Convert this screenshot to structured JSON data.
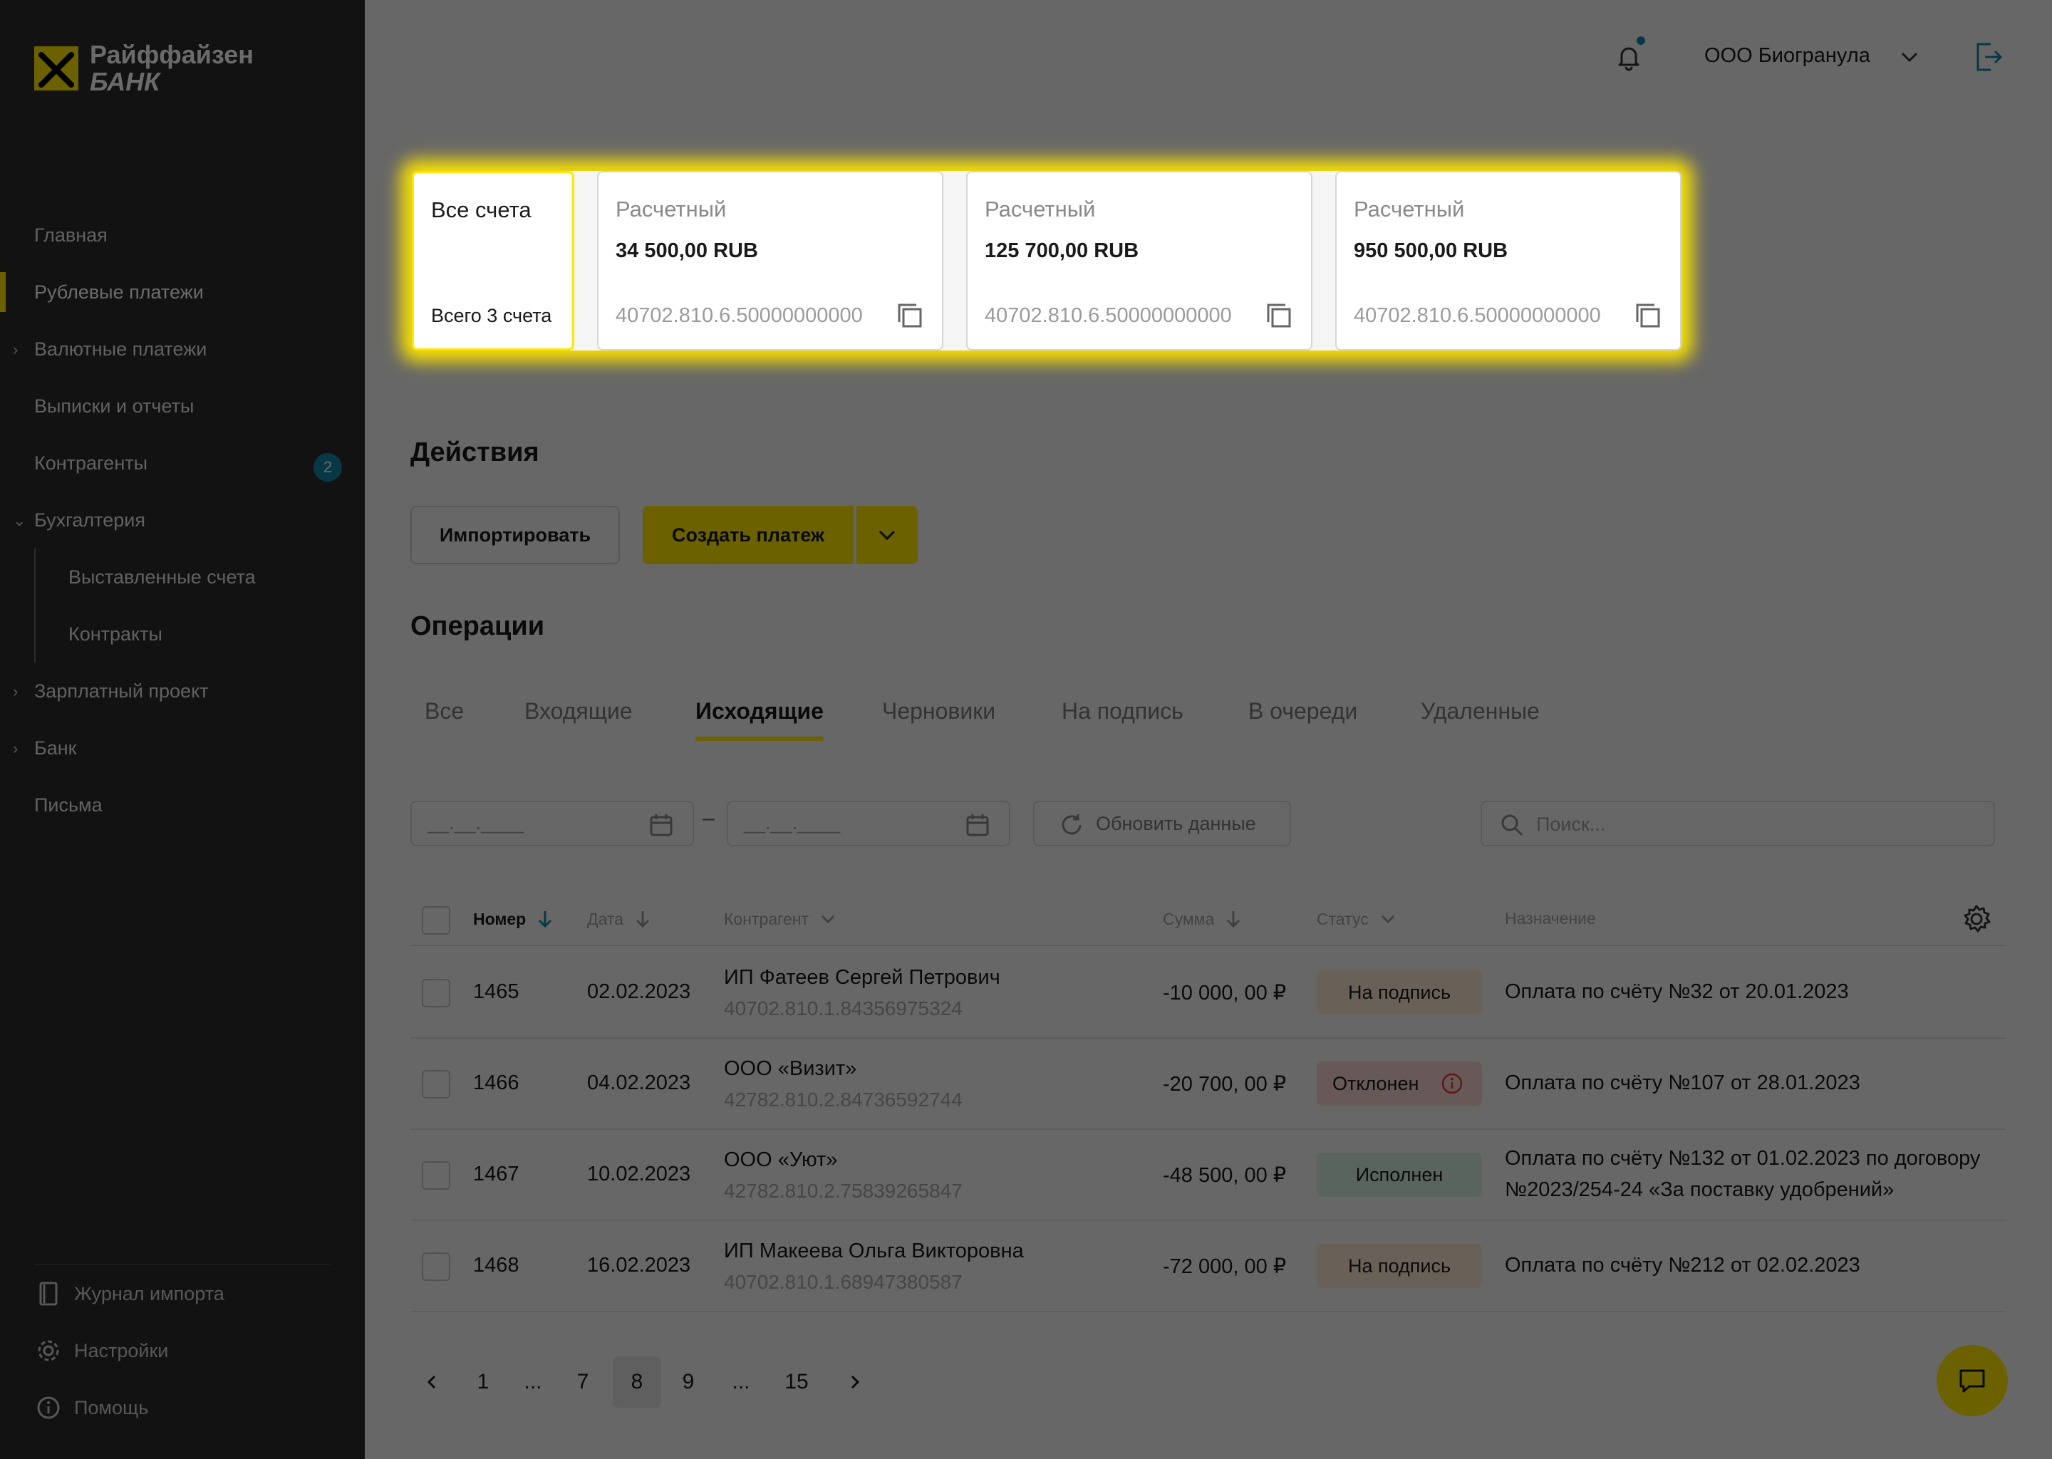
{
  "brand": {
    "line1": "Райффайзен",
    "line2": "БАНК",
    "color": "#fee600"
  },
  "sidebar": {
    "items": [
      {
        "label": "Главная",
        "active": false
      },
      {
        "label": "Рублевые платежи",
        "active": true
      },
      {
        "label": "Валютные платежи",
        "expandable": true
      },
      {
        "label": "Выписки и отчеты"
      },
      {
        "label": "Контрагенты",
        "badge": "2"
      },
      {
        "label": "Бухгалтерия",
        "expanded": true
      },
      {
        "label": "Выставленные счета",
        "sub": true
      },
      {
        "label": "Контракты",
        "sub": true
      },
      {
        "label": "Зарплатный проект",
        "expandable": true
      },
      {
        "label": "Банк",
        "expandable": true
      },
      {
        "label": "Письма"
      }
    ],
    "bottom": [
      {
        "label": "Журнал импорта",
        "icon": "import-log-icon"
      },
      {
        "label": "Настройки",
        "icon": "gear-icon"
      },
      {
        "label": "Помощь",
        "icon": "info-icon"
      }
    ]
  },
  "header": {
    "company": "ООО Биогранула"
  },
  "accounts": {
    "all": {
      "label": "Все счета",
      "total": "Всего 3 счета"
    },
    "cards": [
      {
        "label": "Расчетный",
        "amount": "34 500,00 RUB",
        "number": "40702.810.6.50000000000"
      },
      {
        "label": "Расчетный",
        "amount": "125 700,00 RUB",
        "number": "40702.810.6.50000000000"
      },
      {
        "label": "Расчетный",
        "amount": "950 500,00 RUB",
        "number": "40702.810.6.50000000000"
      }
    ]
  },
  "actions": {
    "title": "Действия",
    "import": "Импортировать",
    "create": "Создать платеж"
  },
  "operations": {
    "title": "Операции",
    "tabs": [
      "Все",
      "Входящие",
      "Исходящие",
      "Черновики",
      "На подпись",
      "В очереди",
      "Удаленные"
    ],
    "active_tab": "Исходящие",
    "date_mask": "__.__.____",
    "refresh": "Обновить данные",
    "search_placeholder": "Поиск...",
    "columns": {
      "number": "Номер",
      "date": "Дата",
      "counterparty": "Контрагент",
      "sum": "Сумма",
      "status": "Статус",
      "purpose": "Назначение"
    },
    "rows": [
      {
        "number": "1465",
        "date": "02.02.2023",
        "name": "ИП Фатеев Сергей Петрович",
        "account": "40702.810.1.84356975324",
        "sum": "-10 000, 00 ₽",
        "status": "На подпись",
        "purpose": "Оплата по счёту №32 от 20.01.2023"
      },
      {
        "number": "1466",
        "date": "04.02.2023",
        "name": "ООО «Визит»",
        "account": "42782.810.2.84736592744",
        "sum": "-20 700, 00 ₽",
        "status": "Отклонен",
        "purpose": "Оплата по счёту №107 от 28.01.2023"
      },
      {
        "number": "1467",
        "date": "10.02.2023",
        "name": "ООО «Уют»",
        "account": "42782.810.2.75839265847",
        "sum": "-48 500, 00 ₽",
        "status": "Исполнен",
        "purpose": "Оплата по счёту №132 от 01.02.2023 по договору №2023/254-24 «За поставку удобрений»"
      },
      {
        "number": "1468",
        "date": "16.02.2023",
        "name": "ИП Макеева Ольга Викторовна",
        "account": "40702.810.1.68947380587",
        "sum": "-72 000, 00 ₽",
        "status": "На подпись",
        "purpose": "Оплата по счёту №212 от 02.02.2023"
      }
    ]
  },
  "pagination": {
    "pages": [
      "1",
      "...",
      "7",
      "8",
      "9",
      "...",
      "15"
    ],
    "current": "8"
  }
}
